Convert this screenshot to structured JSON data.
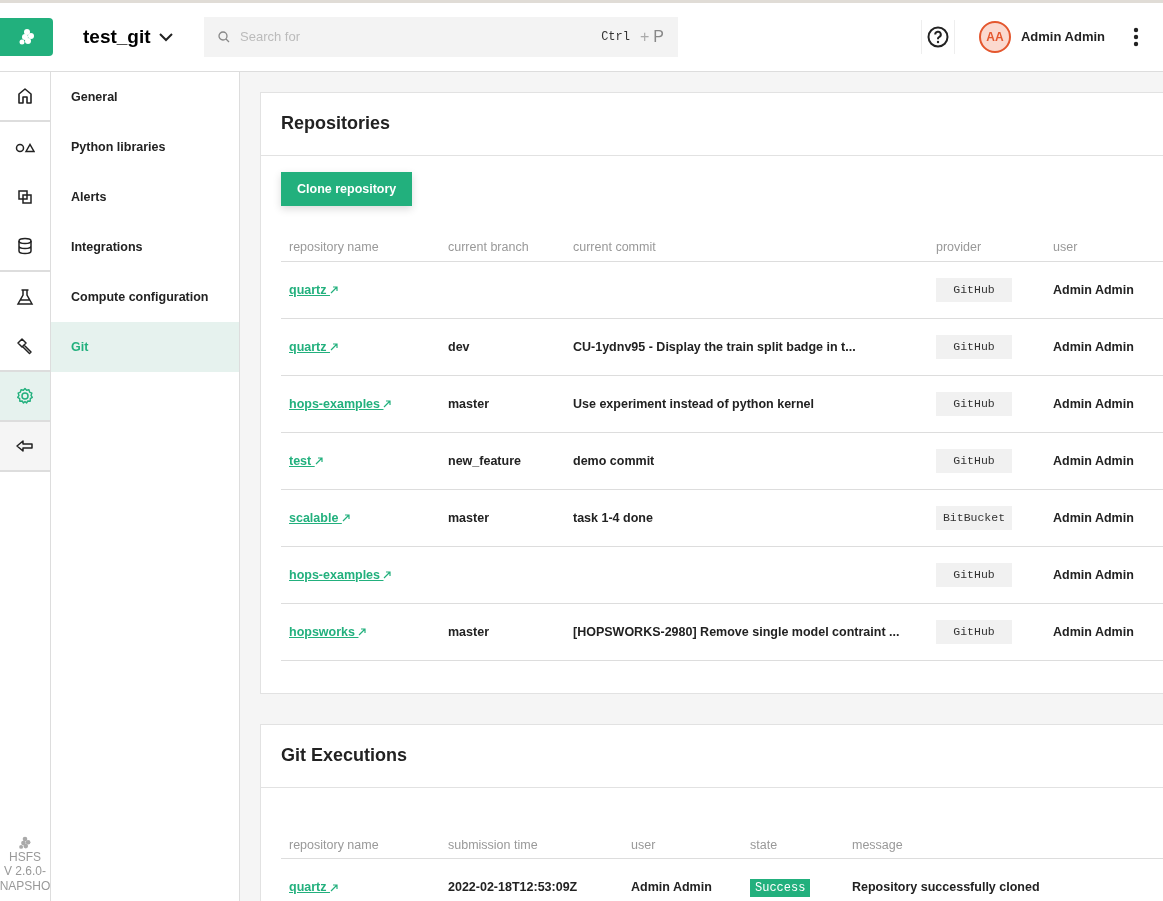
{
  "header": {
    "project": "test_git",
    "search": {
      "placeholder": "Search for",
      "shortcut_key": "Ctrl",
      "shortcut_plus": "+",
      "shortcut_letter": "P"
    },
    "user": {
      "initials": "AA",
      "name": "Admin Admin"
    }
  },
  "rail": {
    "items": [
      {
        "selected": false,
        "group_end": true
      },
      {
        "selected": false,
        "group_end": false
      },
      {
        "selected": false,
        "group_end": false
      },
      {
        "selected": false,
        "group_end": true
      },
      {
        "selected": false,
        "group_end": false
      },
      {
        "selected": false,
        "group_end": true
      },
      {
        "selected": true,
        "group_end": true
      },
      {
        "selected": false,
        "group_end": true
      }
    ],
    "version_name": "HSFS",
    "version": "V 2.6.0-",
    "version_suffix": "NAPSHO"
  },
  "settings_menu": [
    {
      "label": "General",
      "selected": false
    },
    {
      "label": "Python libraries",
      "selected": false
    },
    {
      "label": "Alerts",
      "selected": false
    },
    {
      "label": "Integrations",
      "selected": false
    },
    {
      "label": "Compute configuration",
      "selected": false
    },
    {
      "label": "Git",
      "selected": true
    }
  ],
  "repositories": {
    "title": "Repositories",
    "clone_button": "Clone repository",
    "columns": [
      "repository name",
      "current branch",
      "current commit",
      "provider",
      "user"
    ],
    "rows": [
      {
        "name": "quartz",
        "branch": "",
        "commit": "",
        "provider": "GitHub",
        "user": "Admin Admin"
      },
      {
        "name": "quartz",
        "branch": "dev",
        "commit": "CU-1ydnv95 - Display the train split badge in t...",
        "provider": "GitHub",
        "user": "Admin Admin"
      },
      {
        "name": "hops-examples",
        "branch": "master",
        "commit": "Use experiment instead of python kernel",
        "provider": "GitHub",
        "user": "Admin Admin"
      },
      {
        "name": "test",
        "branch": "new_feature",
        "commit": "demo commit",
        "provider": "GitHub",
        "user": "Admin Admin"
      },
      {
        "name": "scalable",
        "branch": "master",
        "commit": "task 1-4 done",
        "provider": "BitBucket",
        "user": "Admin Admin"
      },
      {
        "name": "hops-examples",
        "branch": "",
        "commit": "",
        "provider": "GitHub",
        "user": "Admin Admin"
      },
      {
        "name": "hopsworks",
        "branch": "master",
        "commit": "[HOPSWORKS-2980] Remove single model contraint ...",
        "provider": "GitHub",
        "user": "Admin Admin"
      }
    ]
  },
  "executions": {
    "title": "Git Executions",
    "columns": [
      "repository name",
      "submission time",
      "user",
      "state",
      "message"
    ],
    "rows": [
      {
        "name": "quartz",
        "time": "2022-02-18T12:53:09Z",
        "user": "Admin Admin",
        "state": "Success",
        "message": "Repository successfully cloned"
      }
    ]
  }
}
